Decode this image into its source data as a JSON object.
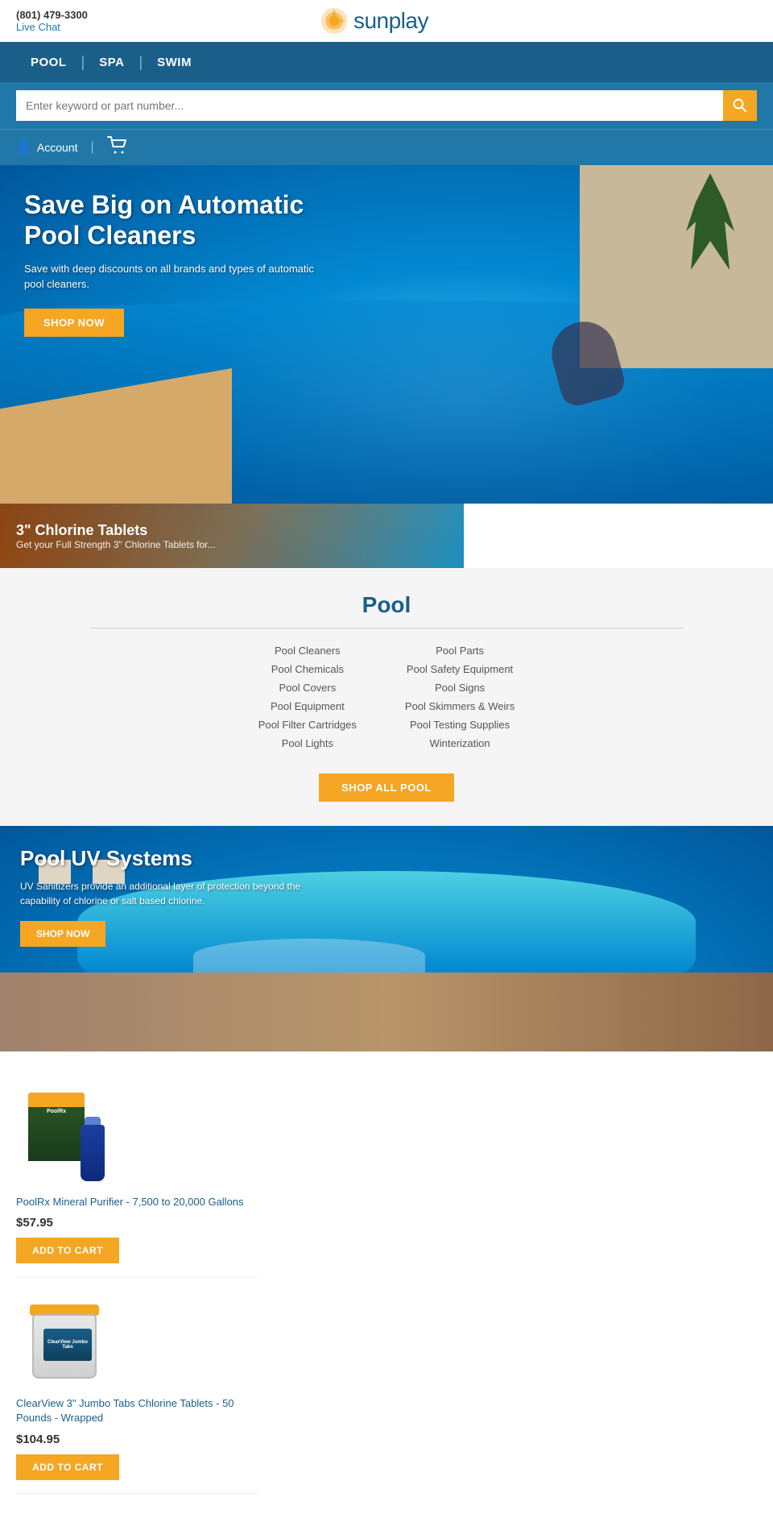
{
  "site": {
    "phone": "(801) 479-3300",
    "live_chat": "Live Chat",
    "logo_text": "sunplay"
  },
  "nav": {
    "items": [
      "POOL",
      "SPA",
      "SWIM"
    ]
  },
  "search": {
    "placeholder": "Enter keyword or part number..."
  },
  "account": {
    "label": "Account"
  },
  "hero": {
    "title": "Save Big on Automatic Pool Cleaners",
    "subtitle": "Save with deep discounts on all brands and types of automatic pool cleaners.",
    "cta_label": "SHOP NOW"
  },
  "chlorine_strip": {
    "title": "3\" Chlorine Tablets",
    "subtitle": "Get your Full Strength 3\" Chlorine Tablets for..."
  },
  "pool_section": {
    "title": "Pool",
    "categories_left": [
      "Pool Cleaners",
      "Pool Chemicals",
      "Pool Covers",
      "Pool Equipment",
      "Pool Filter Cartridges",
      "Pool Lights"
    ],
    "categories_right": [
      "Pool Parts",
      "Pool Safety Equipment",
      "Pool Signs",
      "Pool Skimmers & Weirs",
      "Pool Testing Supplies",
      "Winterization"
    ],
    "shop_all_label": "SHOP ALL POOL"
  },
  "uv_banner": {
    "title": "Pool UV Systems",
    "subtitle": "UV Sanitizers provide an additional layer of protection beyond the capability of chlorine or salt based chlorine.",
    "cta_label": "SHOP NOW"
  },
  "products": [
    {
      "name": "PoolRx Mineral Purifier - 7,500 to 20,000 Gallons",
      "price": "$57.95",
      "add_to_cart": "ADD TO CART",
      "type": "poolrx"
    },
    {
      "name": "ClearView 3\" Jumbo Tabs Chlorine Tablets - 50 Pounds - Wrapped",
      "price": "$104.95",
      "add_to_cart": "ADD TO CART",
      "type": "clearview"
    }
  ],
  "colors": {
    "primary_blue": "#1a5f8a",
    "header_blue": "#2178a8",
    "orange": "#f5a623",
    "white": "#ffffff"
  }
}
